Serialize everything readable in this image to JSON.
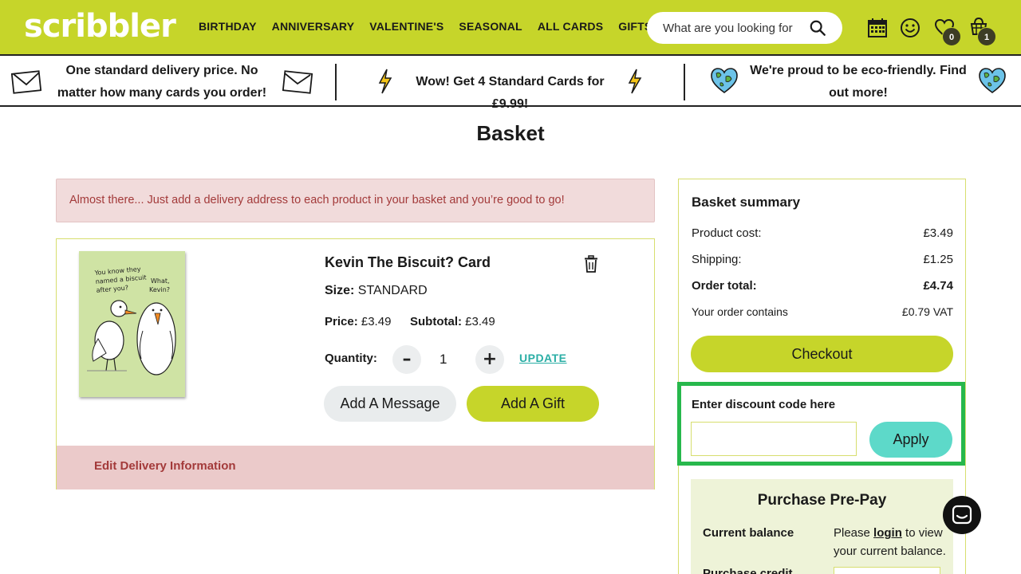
{
  "brand": {
    "logo_text": "scribbler",
    "accent": "#c6d52a",
    "teal": "#5dd9c9",
    "highlight": "#27b84c"
  },
  "nav": {
    "items": [
      "BIRTHDAY",
      "ANNIVERSARY",
      "VALENTINE'S",
      "SEASONAL",
      "ALL CARDS",
      "GIFTS"
    ],
    "search_placeholder": "What are you looking for",
    "wishlist_count": "0",
    "basket_count": "1",
    "icons": [
      "calendar-icon",
      "smiley-icon",
      "heart-icon",
      "basket-icon",
      "search-icon"
    ]
  },
  "promo": {
    "delivery": "One standard delivery price. No matter how many cards you order!",
    "offer": "Wow! Get 4 Standard Cards for £9.99!",
    "eco": "We're proud to be eco-friendly. Find out more!"
  },
  "page": {
    "title": "Basket"
  },
  "alert": {
    "text": "Almost there... Just add a delivery address to each product in your basket and you’re good to go!"
  },
  "product": {
    "name": "Kevin The Biscuit? Card",
    "size_label": "Size:",
    "size_value": "STANDARD",
    "price_label": "Price:",
    "price_value": "£3.49",
    "subtotal_label": "Subtotal:",
    "subtotal_value": "£3.49",
    "quantity_label": "Quantity:",
    "quantity_value": "1",
    "minus": "–",
    "plus": "+",
    "update_label": "UPDATE",
    "add_message_label": "Add A Message",
    "add_gift_label": "Add A Gift",
    "edit_delivery_label": "Edit Delivery Information",
    "card_text_1": "You know they named a biscuit after you?",
    "card_text_2": "What, Kevin?"
  },
  "summary": {
    "title": "Basket summary",
    "product_cost_label": "Product cost:",
    "product_cost_value": "£3.49",
    "shipping_label": "Shipping:",
    "shipping_value": "£1.25",
    "order_total_label": "Order total:",
    "order_total_value": "£4.74",
    "vat_label": "Your order contains",
    "vat_value": "£0.79 VAT",
    "checkout_label": "Checkout",
    "discount_label": "Enter discount code here",
    "discount_value": "",
    "apply_label": "Apply"
  },
  "prepay": {
    "title": "Purchase Pre-Pay",
    "balance_label": "Current balance",
    "balance_text_pre": "Please",
    "login_label": "login",
    "balance_text_post": "to view your current balance.",
    "purchase_label": "Purchase credit"
  }
}
